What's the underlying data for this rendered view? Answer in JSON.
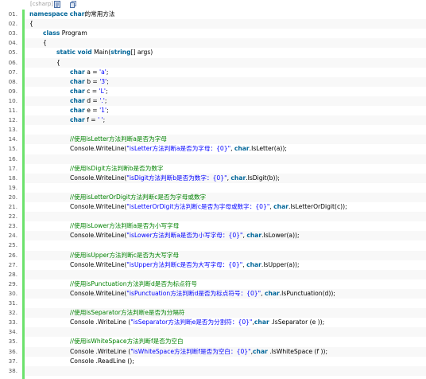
{
  "toolbar": {
    "language_label": "[csharp]",
    "view_source_icon": "view-source-icon",
    "copy_icon": "copy-icon"
  },
  "colors": {
    "gutter_bar": "#6ce26c",
    "keyword": "#006699",
    "string": "#0000ff",
    "comment": "#008200",
    "line_number": "#5a5a5a"
  },
  "lines": [
    {
      "n": "01.",
      "indent": 0,
      "tokens": [
        {
          "t": "namespace",
          "c": "kw"
        },
        {
          "t": " "
        },
        {
          "t": "char",
          "c": "kw"
        },
        {
          "t": "的常用方法"
        }
      ]
    },
    {
      "n": "02.",
      "indent": 0,
      "tokens": [
        {
          "t": "{"
        }
      ]
    },
    {
      "n": "03.",
      "indent": 1,
      "tokens": [
        {
          "t": "class",
          "c": "kw"
        },
        {
          "t": " Program"
        }
      ]
    },
    {
      "n": "04.",
      "indent": 1,
      "tokens": [
        {
          "t": "{"
        }
      ]
    },
    {
      "n": "05.",
      "indent": 2,
      "tokens": [
        {
          "t": "static",
          "c": "kw"
        },
        {
          "t": " "
        },
        {
          "t": "void",
          "c": "kw"
        },
        {
          "t": " Main("
        },
        {
          "t": "string",
          "c": "kw"
        },
        {
          "t": "[] args)"
        }
      ]
    },
    {
      "n": "06.",
      "indent": 2,
      "tokens": [
        {
          "t": "{"
        }
      ]
    },
    {
      "n": "07.",
      "indent": 3,
      "tokens": [
        {
          "t": "char",
          "c": "kw"
        },
        {
          "t": " a = "
        },
        {
          "t": "'a'",
          "c": "str"
        },
        {
          "t": ";"
        }
      ]
    },
    {
      "n": "08.",
      "indent": 3,
      "tokens": [
        {
          "t": "char",
          "c": "kw"
        },
        {
          "t": " b = "
        },
        {
          "t": "'3'",
          "c": "str"
        },
        {
          "t": ";"
        }
      ]
    },
    {
      "n": "09.",
      "indent": 3,
      "tokens": [
        {
          "t": "char",
          "c": "kw"
        },
        {
          "t": " c = "
        },
        {
          "t": "'L'",
          "c": "str"
        },
        {
          "t": ";"
        }
      ]
    },
    {
      "n": "10.",
      "indent": 3,
      "tokens": [
        {
          "t": "char",
          "c": "kw"
        },
        {
          "t": " d = "
        },
        {
          "t": "'.'",
          "c": "str"
        },
        {
          "t": ";"
        }
      ]
    },
    {
      "n": "11.",
      "indent": 3,
      "tokens": [
        {
          "t": "char",
          "c": "kw"
        },
        {
          "t": " e = "
        },
        {
          "t": "'1'",
          "c": "str"
        },
        {
          "t": ";"
        }
      ]
    },
    {
      "n": "12.",
      "indent": 3,
      "tokens": [
        {
          "t": "char",
          "c": "kw"
        },
        {
          "t": " f = "
        },
        {
          "t": "' '",
          "c": "str"
        },
        {
          "t": ";"
        }
      ]
    },
    {
      "n": "13.",
      "indent": 0,
      "tokens": []
    },
    {
      "n": "14.",
      "indent": 3,
      "tokens": [
        {
          "t": "//使用isLetter方法判断a是否为字母",
          "c": "cmt"
        }
      ]
    },
    {
      "n": "15.",
      "indent": 3,
      "tokens": [
        {
          "t": "Console.WriteLine("
        },
        {
          "t": "\"isLetter方法判断a是否为字母：{0}\"",
          "c": "str"
        },
        {
          "t": ", "
        },
        {
          "t": "char",
          "c": "kw"
        },
        {
          "t": ".IsLetter(a));"
        }
      ]
    },
    {
      "n": "16.",
      "indent": 0,
      "tokens": []
    },
    {
      "n": "17.",
      "indent": 3,
      "tokens": [
        {
          "t": "//使用IsDigit方法判断b是否为数字",
          "c": "cmt"
        }
      ]
    },
    {
      "n": "18.",
      "indent": 3,
      "tokens": [
        {
          "t": "Console.WriteLine("
        },
        {
          "t": "\"isDigit方法判断b是否为数字：{0}\"",
          "c": "str"
        },
        {
          "t": ", "
        },
        {
          "t": "char",
          "c": "kw"
        },
        {
          "t": ".IsDigit(b));"
        }
      ]
    },
    {
      "n": "19.",
      "indent": 0,
      "tokens": []
    },
    {
      "n": "20.",
      "indent": 3,
      "tokens": [
        {
          "t": "//使用isLetterOrDigit方法判断c是否为字母或数字",
          "c": "cmt"
        }
      ]
    },
    {
      "n": "21.",
      "indent": 3,
      "tokens": [
        {
          "t": "Console.WriteLine("
        },
        {
          "t": "\"isLetterOrDigit方法判断c是否为字母或数字：{0}\"",
          "c": "str"
        },
        {
          "t": ", "
        },
        {
          "t": "char",
          "c": "kw"
        },
        {
          "t": ".IsLetterOrDigit(c));"
        }
      ]
    },
    {
      "n": "22.",
      "indent": 0,
      "tokens": []
    },
    {
      "n": "23.",
      "indent": 3,
      "tokens": [
        {
          "t": "//使用isLower方法判断a是否为小写字母",
          "c": "cmt"
        }
      ]
    },
    {
      "n": "24.",
      "indent": 3,
      "tokens": [
        {
          "t": "Console.WriteLine("
        },
        {
          "t": "\"isLower方法判断a是否为小写字母：{0}\"",
          "c": "str"
        },
        {
          "t": ", "
        },
        {
          "t": "char",
          "c": "kw"
        },
        {
          "t": ".IsLower(a));"
        }
      ]
    },
    {
      "n": "25.",
      "indent": 0,
      "tokens": []
    },
    {
      "n": "26.",
      "indent": 3,
      "tokens": [
        {
          "t": "//使用isUpper方法判断c是否为大写字母",
          "c": "cmt"
        }
      ]
    },
    {
      "n": "27.",
      "indent": 3,
      "tokens": [
        {
          "t": "Console.WriteLine("
        },
        {
          "t": "\"isUpper方法判断c是否为大写字母：{0}\"",
          "c": "str"
        },
        {
          "t": ", "
        },
        {
          "t": "char",
          "c": "kw"
        },
        {
          "t": ".IsUpper(a));"
        }
      ]
    },
    {
      "n": "28.",
      "indent": 0,
      "tokens": []
    },
    {
      "n": "29.",
      "indent": 3,
      "tokens": [
        {
          "t": "//使用isPunctuation方法判断d是否为标点符号",
          "c": "cmt"
        }
      ]
    },
    {
      "n": "30.",
      "indent": 3,
      "tokens": [
        {
          "t": "Console.WriteLine("
        },
        {
          "t": "\"isPunctuation方法判断d是否为标点符号：{0}\"",
          "c": "str"
        },
        {
          "t": ", "
        },
        {
          "t": "char",
          "c": "kw"
        },
        {
          "t": ".IsPunctuation(d));"
        }
      ]
    },
    {
      "n": "31.",
      "indent": 0,
      "tokens": []
    },
    {
      "n": "32.",
      "indent": 3,
      "tokens": [
        {
          "t": "//使用isSeparator方法判断e是否为分隔符",
          "c": "cmt"
        }
      ]
    },
    {
      "n": "33.",
      "indent": 3,
      "tokens": [
        {
          "t": "Console .WriteLine ("
        },
        {
          "t": "\"isSeparator方法判断e是否为分割符：{0}\"",
          "c": "str"
        },
        {
          "t": ","
        },
        {
          "t": "char",
          "c": "kw"
        },
        {
          "t": " .IsSeparator (e ));"
        }
      ]
    },
    {
      "n": "34.",
      "indent": 0,
      "tokens": []
    },
    {
      "n": "35.",
      "indent": 3,
      "tokens": [
        {
          "t": "//使用isWhiteSpace方法判断f是否为空白",
          "c": "cmt"
        }
      ]
    },
    {
      "n": "36.",
      "indent": 3,
      "tokens": [
        {
          "t": "Console .WriteLine ("
        },
        {
          "t": "\"isWhiteSpace方法判断f是否为空白：{0}\"",
          "c": "str"
        },
        {
          "t": ","
        },
        {
          "t": "char",
          "c": "kw"
        },
        {
          "t": " .IsWhiteSpace (f ));"
        }
      ]
    },
    {
      "n": "37.",
      "indent": 3,
      "tokens": [
        {
          "t": "Console .ReadLine ();"
        }
      ]
    },
    {
      "n": "38.",
      "indent": 0,
      "tokens": []
    }
  ]
}
